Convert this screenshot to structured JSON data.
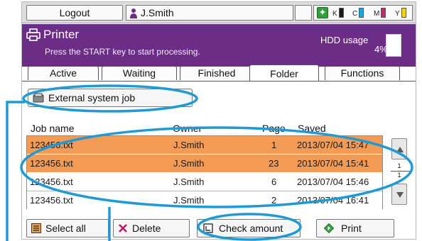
{
  "topbar": {
    "logout_label": "Logout",
    "user_name": "J.Smith",
    "eco_icon": "eco-leaf-icon",
    "toners": [
      {
        "letter": "K",
        "color": "#1a1a1a",
        "level": 0.85
      },
      {
        "letter": "C",
        "color": "#1aa7e0",
        "level": 0.85
      },
      {
        "letter": "M",
        "color": "#d0246f",
        "level": 0.85
      },
      {
        "letter": "Y",
        "color": "#f5d21a",
        "level": 0.85
      }
    ]
  },
  "header": {
    "title": "Printer",
    "message": "Press the START key to start processing.",
    "hdd_label": "HDD usage",
    "hdd_value": "4%",
    "accent_color": "#6b2d86"
  },
  "tabs": [
    {
      "label": "Active",
      "active": false
    },
    {
      "label": "Waiting",
      "active": false
    },
    {
      "label": "Finished",
      "active": false
    },
    {
      "label": "Folder",
      "active": true
    },
    {
      "label": "Functions",
      "active": false
    }
  ],
  "external_job_label": "External system job",
  "table": {
    "columns": [
      "Job name",
      "Owner",
      "Page",
      "Saved"
    ],
    "rows": [
      {
        "name": "123456.txt",
        "owner": "J.Smith",
        "pages": "1",
        "saved": "2013/07/04 15:47",
        "selected": true
      },
      {
        "name": "123456.txt",
        "owner": "J.Smith",
        "pages": "23",
        "saved": "2013/07/04 15:41",
        "selected": true
      },
      {
        "name": "123456.txt",
        "owner": "J.Smith",
        "pages": "6",
        "saved": "2013/07/04 15:46",
        "selected": false
      },
      {
        "name": "123456.txt",
        "owner": "J.Smith",
        "pages": "2",
        "saved": "2013/07/04 16:41",
        "selected": false
      }
    ],
    "selection_color": "#f39a55"
  },
  "pager": {
    "current": "1",
    "total": "1"
  },
  "buttons": {
    "select_all": "Select all",
    "delete": "Delete",
    "check_amount": "Check amount",
    "print": "Print"
  },
  "annotation_color": "#1e9ad6"
}
